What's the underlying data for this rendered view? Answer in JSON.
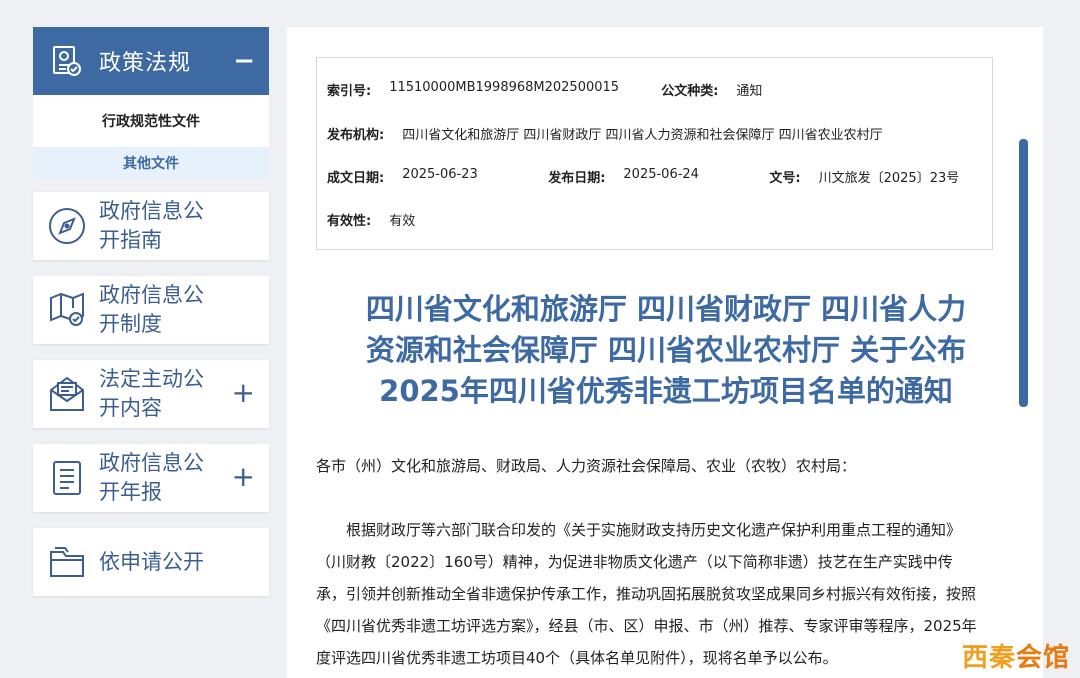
{
  "sidebar": {
    "policy": {
      "title": "政策法规",
      "toggle": "−",
      "icon": "certificate-icon",
      "sub_items": [
        "行政规范性文件",
        "其他文件"
      ]
    },
    "items": [
      {
        "label": "政府信息公开指南",
        "icon": "compass-icon",
        "expand": ""
      },
      {
        "label": "政府信息公开制度",
        "icon": "map-check-icon",
        "expand": ""
      },
      {
        "label": "法定主动公开内容",
        "icon": "mail-open-icon",
        "expand": "+"
      },
      {
        "label": "政府信息公开年报",
        "icon": "document-list-icon",
        "expand": "+"
      },
      {
        "label": "依申请公开",
        "icon": "folder-icon",
        "expand": ""
      }
    ]
  },
  "meta": {
    "index_label": "索引号:",
    "index_value": "11510000MB1998968M202500015",
    "type_label": "公文种类:",
    "type_value": "通知",
    "org_label": "发布机构:",
    "org_value": "四川省文化和旅游厅 四川省财政厅 四川省人力资源和社会保障厅 四川省农业农村厅",
    "created_label": "成文日期:",
    "created_value": "2025-06-23",
    "published_label": "发布日期:",
    "published_value": "2025-06-24",
    "docno_label": "文号:",
    "docno_value": "川文旅发〔2025〕23号",
    "validity_label": "有效性:",
    "validity_value": "有效"
  },
  "document": {
    "title_lines": [
      "四川省文化和旅游厅 四川省财政厅 四川省人力",
      "资源和社会保障厅 四川省农业农村厅 关于公布",
      "2025年四川省优秀非遗工坊项目名单的通知"
    ],
    "greeting": "各市（州）文化和旅游局、财政局、人力资源社会保障局、农业（农牧）农村局：",
    "body": "根据财政厅等六部门联合印发的《关于实施财政支持历史文化遗产保护利用重点工程的通知》（川财教〔2022〕160号）精神，为促进非物质文化遗产（以下简称非遗）技艺在生产实践中传承，引领并创新推动全省非遗保护传承工作，推动巩固拓展脱贫攻坚成果同乡村振兴有效衔接，按照《四川省优秀非遗工坊评选方案》，经县（市、区）申报、市（州）推荐、专家评审等程序，2025年度评选四川省优秀非遗工坊项目40个（具体名单见附件），现将名单予以公布。"
  },
  "watermark": {
    "part1": "西秦",
    "part2": "会馆"
  },
  "colors": {
    "primary": "#3d6aa3",
    "sub_bg": "#e7f1fb",
    "page_bg": "#eef0f3"
  }
}
